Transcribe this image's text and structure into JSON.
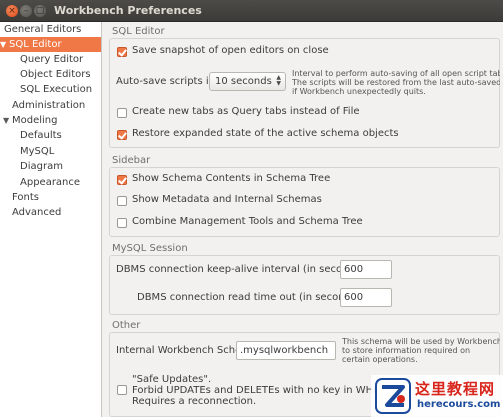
{
  "window": {
    "title": "Workbench Preferences"
  },
  "window_controls": {
    "close": "×",
    "minimize": "–",
    "maximize": "□"
  },
  "sidebar": {
    "items": [
      {
        "label": "General Editors",
        "arrow": ""
      },
      {
        "label": "SQL Editor",
        "arrow": "▼"
      },
      {
        "label": "Query Editor",
        "arrow": ""
      },
      {
        "label": "Object Editors",
        "arrow": ""
      },
      {
        "label": "SQL Execution",
        "arrow": ""
      },
      {
        "label": "Administration",
        "arrow": ""
      },
      {
        "label": "Modeling",
        "arrow": "▼"
      },
      {
        "label": "Defaults",
        "arrow": ""
      },
      {
        "label": "MySQL",
        "arrow": ""
      },
      {
        "label": "Diagram",
        "arrow": ""
      },
      {
        "label": "Appearance",
        "arrow": ""
      },
      {
        "label": "Fonts",
        "arrow": ""
      },
      {
        "label": "Advanced",
        "arrow": ""
      }
    ],
    "selected": "SQL Editor"
  },
  "sql_editor": {
    "title": "SQL Editor",
    "save_snapshot": {
      "label": "Save snapshot of open editors on close",
      "checked": true
    },
    "autosave": {
      "label": "Auto-save scripts int",
      "value": "10 seconds",
      "hint_lines": [
        "Interval to perform auto-saving of all open script tabs",
        "The scripts will be restored from the last auto-saved v",
        "if Workbench unexpectedly quits."
      ]
    },
    "new_tabs_query": {
      "label": "Create new tabs as Query tabs instead of File",
      "checked": false
    },
    "restore_expanded": {
      "label": "Restore expanded state of the active schema objects",
      "checked": true
    }
  },
  "sidebar_section": {
    "title": "Sidebar",
    "show_schema_contents": {
      "label": "Show Schema Contents in Schema Tree",
      "checked": true
    },
    "show_metadata": {
      "label": "Show Metadata and Internal Schemas",
      "checked": false
    },
    "combine_tools": {
      "label": "Combine Management Tools and Schema Tree",
      "checked": false
    }
  },
  "mysql_session": {
    "title": "MySQL Session",
    "keepalive": {
      "label": "DBMS connection keep-alive interval (in seconds):",
      "value": "600"
    },
    "read_timeout": {
      "label": "DBMS connection read time out (in seconds):",
      "value": "600"
    }
  },
  "other": {
    "title": "Other",
    "internal_schema": {
      "label": "Internal Workbench Scher",
      "value": ".mysqlworkbench",
      "hint_lines": [
        "This schema will be used by Workbench",
        "to store information required on",
        "certain operations."
      ]
    },
    "safe_updates": {
      "lines": [
        "\"Safe Updates\".",
        "Forbid UPDATEs and DELETEs with no key in WHERE",
        "Requires a reconnection."
      ],
      "checked": false
    }
  },
  "watermark": {
    "cn": "这里教程网",
    "url": "herecours.com"
  }
}
